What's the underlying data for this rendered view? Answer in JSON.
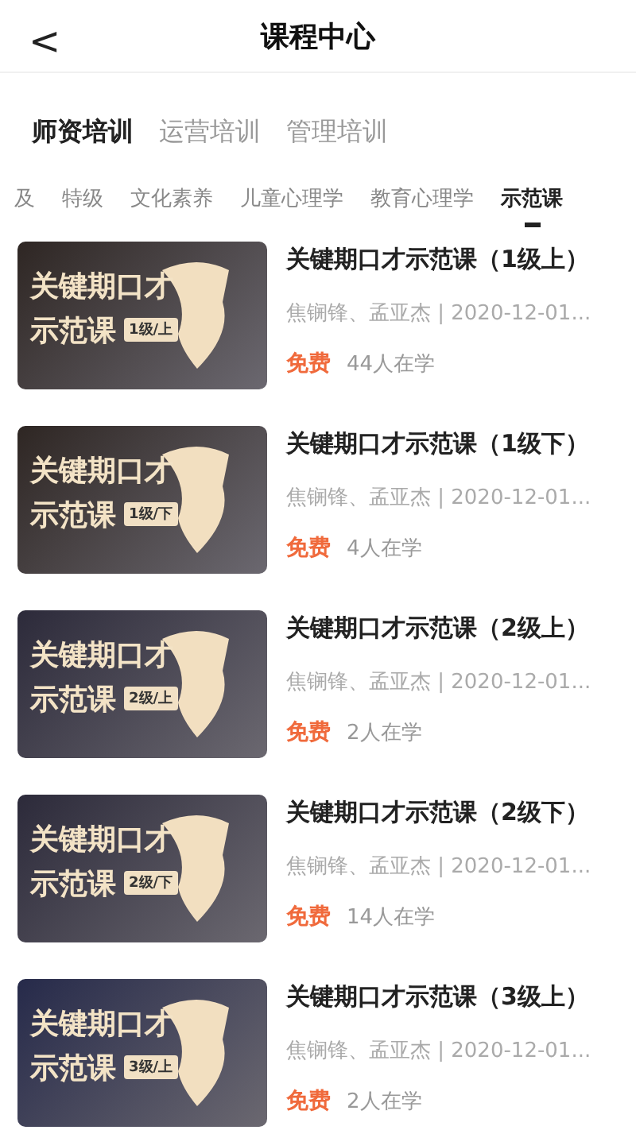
{
  "header": {
    "back": "<",
    "title": "课程中心"
  },
  "primary_tabs": [
    {
      "label": "师资培训",
      "selected": true
    },
    {
      "label": "运营培训",
      "selected": false
    },
    {
      "label": "管理培训",
      "selected": false
    }
  ],
  "secondary_tabs": [
    {
      "label": "及",
      "selected": false
    },
    {
      "label": "特级",
      "selected": false
    },
    {
      "label": "文化素养",
      "selected": false
    },
    {
      "label": "儿童心理学",
      "selected": false
    },
    {
      "label": "教育心理学",
      "selected": false
    },
    {
      "label": "示范课",
      "selected": true
    }
  ],
  "courses": [
    {
      "cover": {
        "line1": "关键期口才",
        "line2": "示范课",
        "badge": "1级/上",
        "color": "#2e2623"
      },
      "title": "关键期口才示范课（1级上）",
      "meta": "焦锎锋、孟亚杰 | 2020-12-01...",
      "price": "免费",
      "learners": "44人在学"
    },
    {
      "cover": {
        "line1": "关键期口才",
        "line2": "示范课",
        "badge": "1级/下",
        "color": "#2e2623"
      },
      "title": "关键期口才示范课（1级下）",
      "meta": "焦锎锋、孟亚杰 | 2020-12-01...",
      "price": "免费",
      "learners": "4人在学"
    },
    {
      "cover": {
        "line1": "关键期口才",
        "line2": "示范课",
        "badge": "2级/上",
        "color": "#2c2a3a"
      },
      "title": "关键期口才示范课（2级上）",
      "meta": "焦锎锋、孟亚杰 | 2020-12-01...",
      "price": "免费",
      "learners": "2人在学"
    },
    {
      "cover": {
        "line1": "关键期口才",
        "line2": "示范课",
        "badge": "2级/下",
        "color": "#2c2a3a"
      },
      "title": "关键期口才示范课（2级下）",
      "meta": "焦锎锋、孟亚杰 | 2020-12-01...",
      "price": "免费",
      "learners": "14人在学"
    },
    {
      "cover": {
        "line1": "关键期口才",
        "line2": "示范课",
        "badge": "3级/上",
        "color": "#262a4a"
      },
      "title": "关键期口才示范课（3级上）",
      "meta": "焦锎锋、孟亚杰 | 2020-12-01...",
      "price": "免费",
      "learners": "2人在学"
    }
  ]
}
